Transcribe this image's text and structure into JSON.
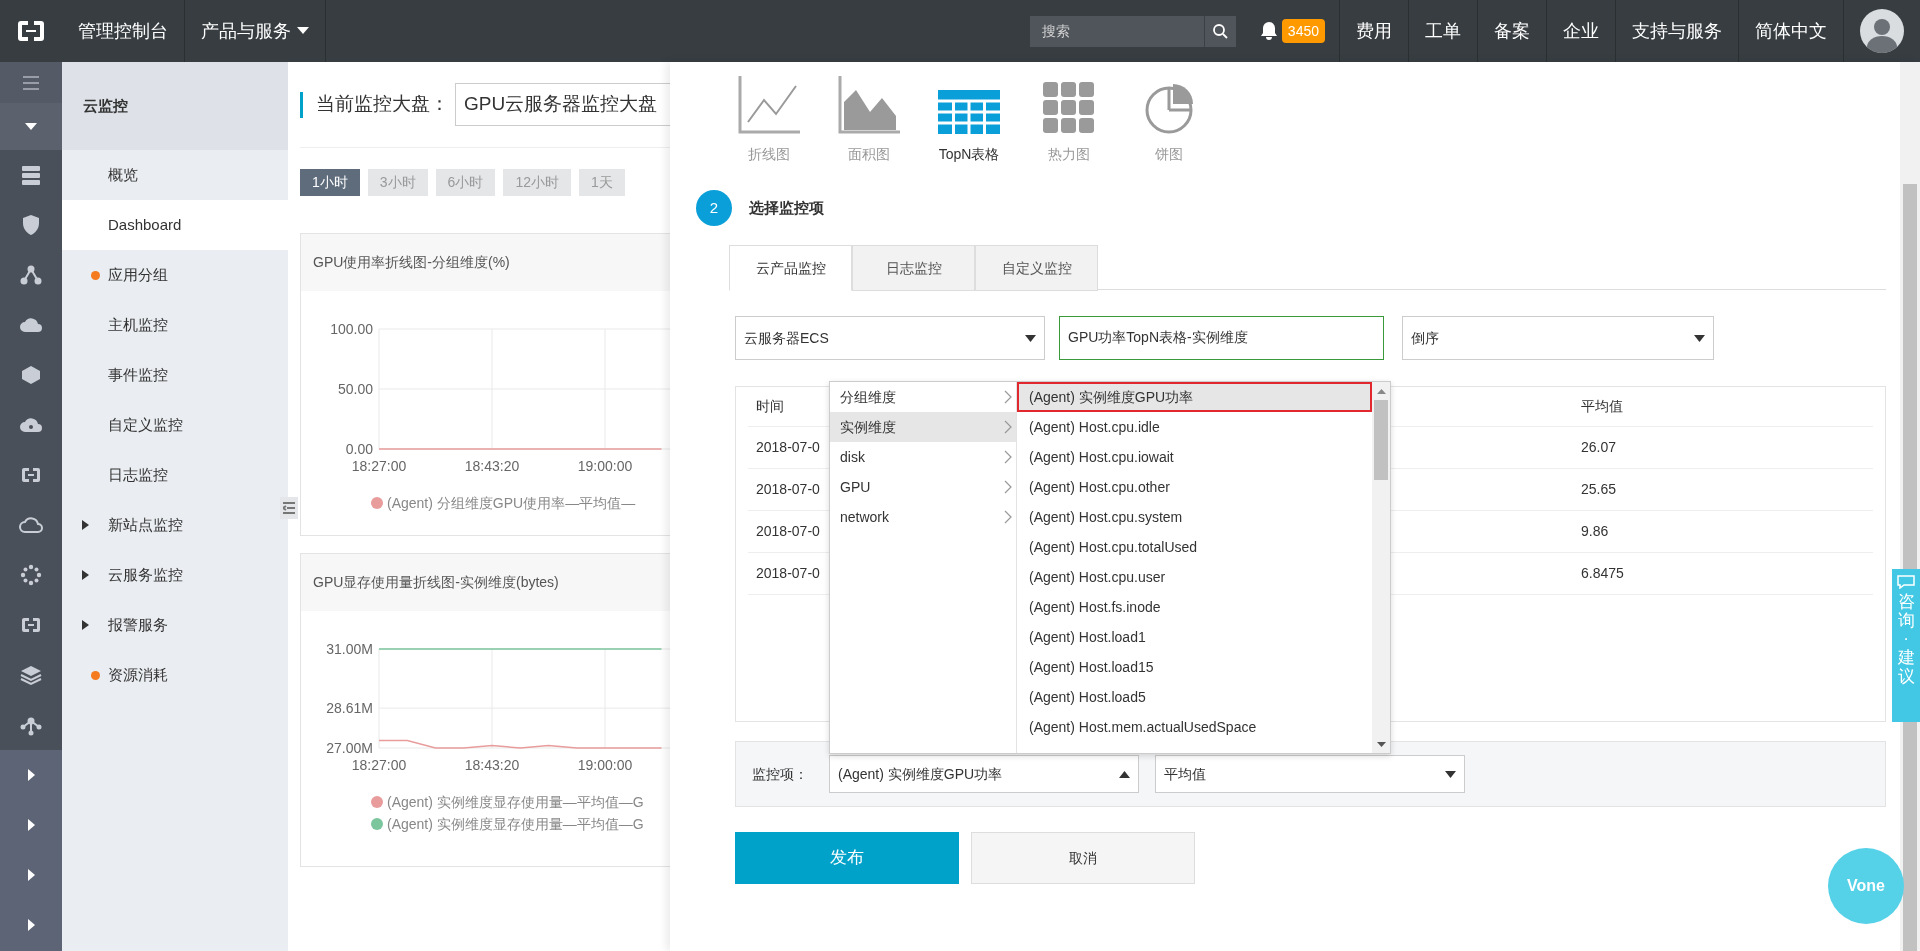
{
  "topbar": {
    "console_title": "管理控制台",
    "products_menu": "产品与服务",
    "search": {
      "placeholder": "搜索"
    },
    "notification_count": "3450",
    "links": [
      "费用",
      "工单",
      "备案",
      "企业",
      "支持与服务",
      "简体中文"
    ]
  },
  "sidebar": {
    "title": "云监控",
    "items": [
      {
        "label": "概览",
        "kind": "plain",
        "selected": false
      },
      {
        "label": "Dashboard",
        "kind": "plain",
        "selected": true
      },
      {
        "label": "应用分组",
        "kind": "dot",
        "selected": false
      },
      {
        "label": "主机监控",
        "kind": "plain",
        "selected": false
      },
      {
        "label": "事件监控",
        "kind": "plain",
        "selected": false
      },
      {
        "label": "自定义监控",
        "kind": "plain",
        "selected": false
      },
      {
        "label": "日志监控",
        "kind": "plain",
        "selected": false
      },
      {
        "label": "新站点监控",
        "kind": "group",
        "expanded": false,
        "selected": false
      },
      {
        "label": "云服务监控",
        "kind": "group",
        "expanded": false,
        "selected": false
      },
      {
        "label": "报警服务",
        "kind": "group",
        "expanded": false,
        "selected": false
      },
      {
        "label": "资源消耗",
        "kind": "dot",
        "selected": false
      }
    ]
  },
  "dashboard": {
    "label": "当前监控大盘：",
    "name": "GPU云服务器监控大盘",
    "time_ranges": [
      {
        "label": "1小时",
        "selected": true
      },
      {
        "label": "3小时",
        "selected": false
      },
      {
        "label": "6小时",
        "selected": false
      },
      {
        "label": "12小时",
        "selected": false
      },
      {
        "label": "1天",
        "selected": false
      }
    ],
    "charts": [
      {
        "title": "GPU使用率折线图-分组维度(%)",
        "chart_data": {
          "type": "line",
          "categories": [
            "18:27:00",
            null,
            null,
            null,
            "18:43:20",
            null,
            null,
            null,
            "19:00:00",
            null,
            null
          ],
          "series": [
            {
              "name": "(Agent) 分组维度GPU使用率—平均值—",
              "color": "#e89c9c",
              "values": [
                0,
                0,
                0,
                0,
                0,
                0,
                0,
                0,
                0,
                0,
                0
              ]
            }
          ],
          "grid": true,
          "ylim": [
            0,
            100
          ],
          "yticks": [
            {
              "value": 0,
              "label": "0.00"
            },
            {
              "value": 50,
              "label": "50.00"
            },
            {
              "value": 100,
              "label": "100.00"
            }
          ]
        }
      },
      {
        "title": "GPU显存使用量折线图-实例维度(bytes)",
        "chart_data": {
          "type": "line",
          "categories": [
            "18:27:00",
            null,
            null,
            null,
            "18:43:20",
            null,
            null,
            null,
            "19:00:00",
            null,
            null
          ],
          "series": [
            {
              "name": "(Agent) 实例维度显存使用量—平均值—G",
              "color": "#e89c9c",
              "values": [
                27.3,
                27.3,
                27.0,
                27.0,
                27.1,
                27.0,
                27.1,
                27.0,
                27.0,
                27.0,
                27.0
              ]
            },
            {
              "name": "(Agent) 实例维度显存使用量—平均值—G",
              "color": "#7cc69e",
              "values": [
                31,
                31,
                31,
                31,
                31,
                31,
                31,
                31,
                31,
                31,
                31
              ]
            }
          ],
          "grid": true,
          "ylim": [
            27,
            31
          ],
          "yticks": [
            {
              "value": 27,
              "label": "27.00M"
            },
            {
              "value": 28.61,
              "label": "28.61M"
            },
            {
              "value": 31,
              "label": "31.00M"
            }
          ]
        }
      }
    ]
  },
  "editor": {
    "chart_types": [
      {
        "label": "折线图",
        "kind": "line",
        "selected": false
      },
      {
        "label": "面积图",
        "kind": "area",
        "selected": false
      },
      {
        "label": "TopN表格",
        "kind": "table",
        "selected": true
      },
      {
        "label": "热力图",
        "kind": "heatmap",
        "selected": false
      },
      {
        "label": "饼图",
        "kind": "pie",
        "selected": false
      }
    ],
    "step": {
      "number": "2",
      "title": "选择监控项"
    },
    "tabs": [
      {
        "label": "云产品监控",
        "selected": true
      },
      {
        "label": "日志监控",
        "selected": false
      },
      {
        "label": "自定义监控",
        "selected": false
      }
    ],
    "product_select": "云服务器ECS",
    "name_field": "GPU功率TopN表格-实例维度",
    "order_select": "倒序",
    "table": {
      "columns": [
        "时间",
        "平均值"
      ],
      "rows": [
        {
          "time": "2018-07-0",
          "value": "26.07"
        },
        {
          "time": "2018-07-0",
          "value": "25.65"
        },
        {
          "time": "2018-07-0",
          "value": "9.86"
        },
        {
          "time": "2018-07-0",
          "value": "6.8475"
        }
      ]
    },
    "cascader": {
      "groups": [
        {
          "label": "分组维度",
          "selected": false
        },
        {
          "label": "实例维度",
          "selected": true
        },
        {
          "label": "disk",
          "selected": false
        },
        {
          "label": "GPU",
          "selected": false
        },
        {
          "label": "network",
          "selected": false
        }
      ],
      "options": [
        {
          "label": "(Agent) 实例维度GPU功率",
          "selected": true,
          "outlined": true
        },
        {
          "label": "(Agent) Host.cpu.idle",
          "selected": false,
          "outlined": false
        },
        {
          "label": "(Agent) Host.cpu.iowait",
          "selected": false,
          "outlined": false
        },
        {
          "label": "(Agent) Host.cpu.other",
          "selected": false,
          "outlined": false
        },
        {
          "label": "(Agent) Host.cpu.system",
          "selected": false,
          "outlined": false
        },
        {
          "label": "(Agent) Host.cpu.totalUsed",
          "selected": false,
          "outlined": false
        },
        {
          "label": "(Agent) Host.cpu.user",
          "selected": false,
          "outlined": false
        },
        {
          "label": "(Agent) Host.fs.inode",
          "selected": false,
          "outlined": false
        },
        {
          "label": "(Agent) Host.load1",
          "selected": false,
          "outlined": false
        },
        {
          "label": "(Agent) Host.load15",
          "selected": false,
          "outlined": false
        },
        {
          "label": "(Agent) Host.load5",
          "selected": false,
          "outlined": false
        },
        {
          "label": "(Agent) Host.mem.actualUsedSpace",
          "selected": false,
          "outlined": false
        }
      ]
    },
    "metric": {
      "label": "监控项：",
      "value": "(Agent) 实例维度GPU功率",
      "open": true
    },
    "aggregate": {
      "value": "平均值",
      "open": false
    },
    "buttons": [
      {
        "label": "发布",
        "kind": "primary"
      },
      {
        "label": "取消",
        "kind": "secondary"
      }
    ]
  },
  "assistant_button": "Vone",
  "feedback_tab": "咨询·建议"
}
